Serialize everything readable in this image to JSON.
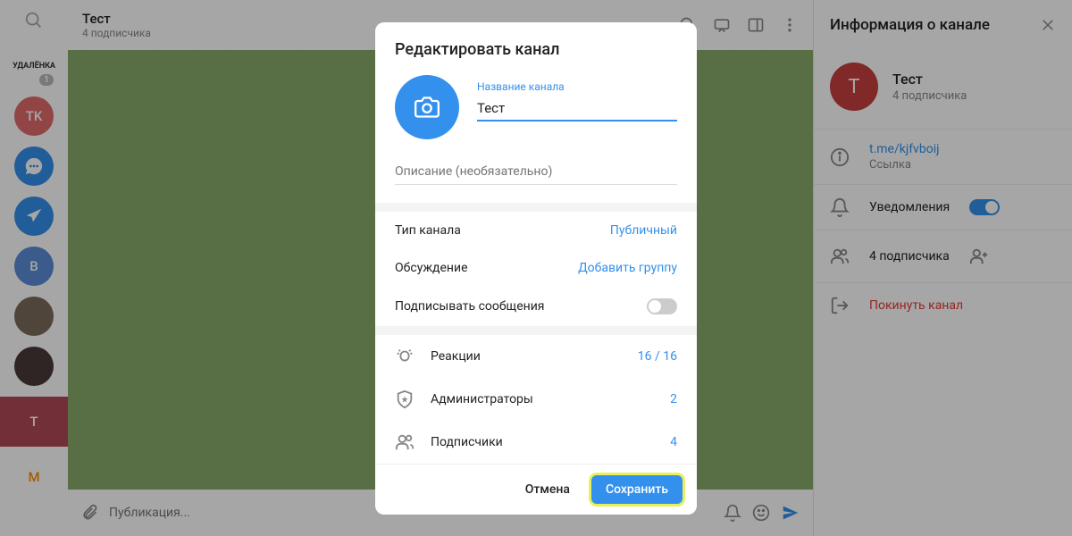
{
  "colors": {
    "accent": "#3390ec",
    "danger": "#e53935"
  },
  "sidebar": {
    "items": [
      {
        "label": "УДАЛЁНКА",
        "bg": "#fff",
        "txt": "#333",
        "badge": "1"
      },
      {
        "label": "TK",
        "bg": "#e06b6b"
      },
      {
        "label": "",
        "bg": "#3390ec",
        "icon": "chat"
      },
      {
        "label": "",
        "bg": "#3390ec",
        "icon": "send"
      },
      {
        "label": "B",
        "bg": "#5a8dd6"
      },
      {
        "label": "",
        "bg": "#7a6a5a",
        "img": true
      },
      {
        "label": "",
        "bg": "#4a3a3a",
        "img": true
      },
      {
        "label": "T",
        "bg": "#c73e3e",
        "active": true
      },
      {
        "label": "M",
        "bg": "#fff",
        "txt": "#ff8c00",
        "sq": true
      }
    ]
  },
  "header": {
    "title": "Тест",
    "subtitle": "4 подписчика"
  },
  "composer": {
    "placeholder": "Публикация..."
  },
  "info": {
    "title": "Информация о канале",
    "name": "Тест",
    "subtitle": "4 подписчика",
    "link": "t.me/kjfvboij",
    "link_label": "Ссылка",
    "notifications": "Уведомления",
    "subs": "4 подписчика",
    "leave": "Покинуть канал"
  },
  "modal": {
    "title": "Редактировать канал",
    "name_label": "Название канала",
    "name_value": "Тест",
    "desc_placeholder": "Описание (необязательно)",
    "type_label": "Тип канала",
    "type_value": "Публичный",
    "discussion_label": "Обсуждение",
    "discussion_value": "Добавить группу",
    "sign_label": "Подписывать сообщения",
    "reactions_label": "Реакции",
    "reactions_count": "16 / 16",
    "admins_label": "Администраторы",
    "admins_count": "2",
    "subs_label": "Подписчики",
    "subs_count": "4",
    "cancel": "Отмена",
    "save": "Сохранить"
  }
}
